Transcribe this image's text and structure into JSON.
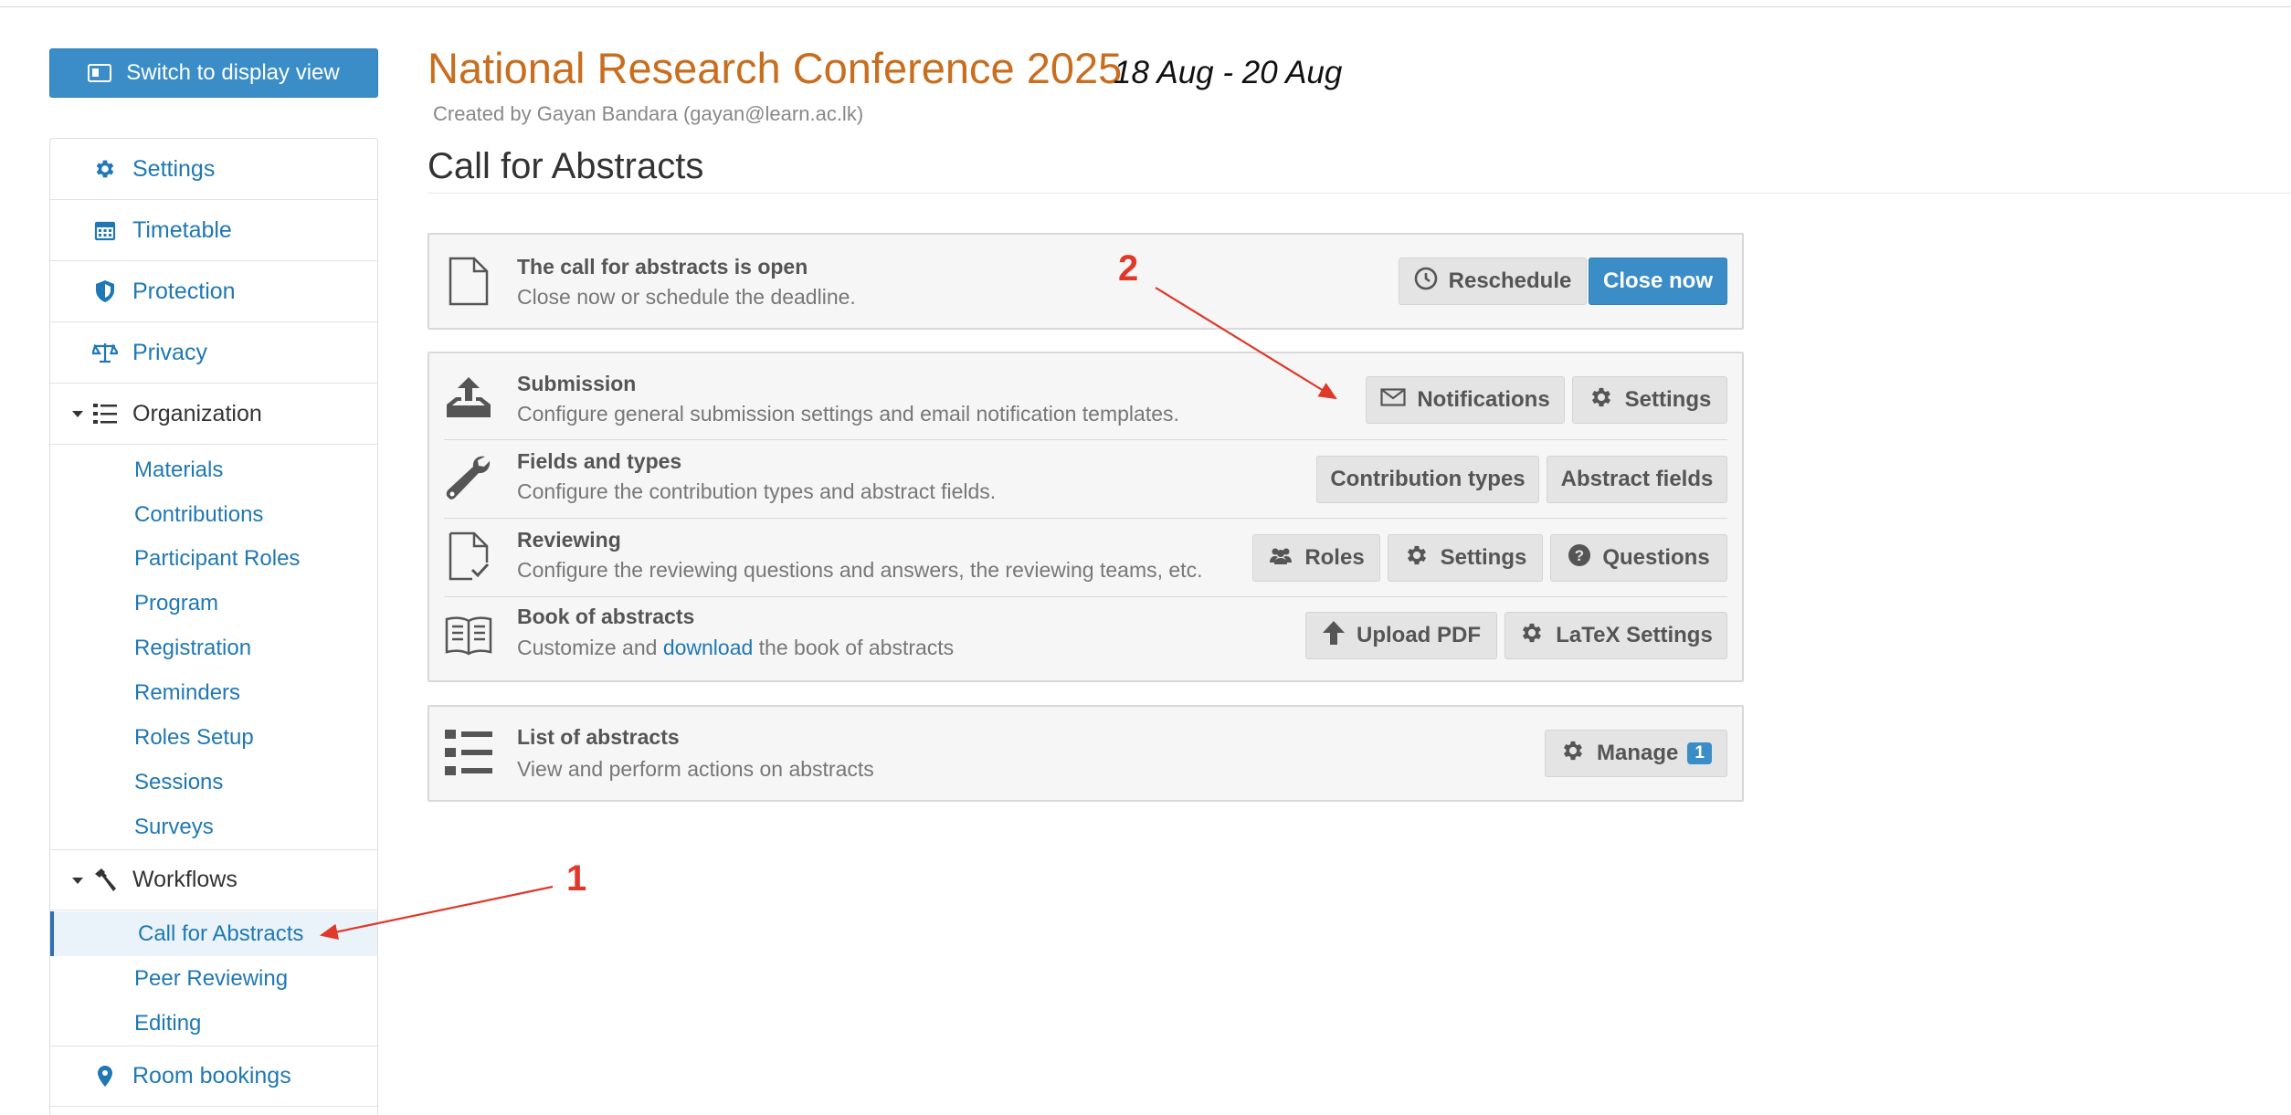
{
  "sidebar": {
    "switch_label": "Switch to display view",
    "items": [
      {
        "label": "Settings"
      },
      {
        "label": "Timetable"
      },
      {
        "label": "Protection"
      },
      {
        "label": "Privacy"
      }
    ],
    "organization": {
      "label": "Organization",
      "items": [
        "Materials",
        "Contributions",
        "Participant Roles",
        "Program",
        "Registration",
        "Reminders",
        "Roles Setup",
        "Sessions",
        "Surveys"
      ]
    },
    "workflows": {
      "label": "Workflows",
      "items": [
        "Call for Abstracts",
        "Peer Reviewing",
        "Editing"
      ],
      "active": "Call for Abstracts"
    },
    "room_bookings": "Room bookings"
  },
  "header": {
    "conference_title": "National Research Conference 2025",
    "dates": "18 Aug - 20 Aug",
    "created_by": "Created by Gayan Bandara (gayan@learn.ac.lk)",
    "page_title": "Call for Abstracts"
  },
  "status_panel": {
    "title": "The call for abstracts is open",
    "desc": "Close now or schedule the deadline.",
    "reschedule": "Reschedule",
    "close_now": "Close now"
  },
  "config_rows": [
    {
      "title": "Submission",
      "desc": "Configure general submission settings and email notification templates.",
      "buttons": [
        "Notifications",
        "Settings"
      ]
    },
    {
      "title": "Fields and types",
      "desc": "Configure the contribution types and abstract fields.",
      "buttons": [
        "Contribution types",
        "Abstract fields"
      ]
    },
    {
      "title": "Reviewing",
      "desc": "Configure the reviewing questions and answers, the reviewing teams, etc.",
      "buttons": [
        "Roles",
        "Settings",
        "Questions"
      ]
    },
    {
      "title": "Book of abstracts",
      "desc_pre": "Customize and ",
      "desc_link": "download",
      "desc_post": " the book of abstracts",
      "buttons": [
        "Upload PDF",
        "LaTeX Settings"
      ]
    }
  ],
  "list_panel": {
    "title": "List of abstracts",
    "desc": "View and perform actions on abstracts",
    "manage": "Manage",
    "badge": "1"
  },
  "annotations": {
    "one": "1",
    "two": "2",
    "color": "#e0382a"
  },
  "colors": {
    "link": "#1f78b4",
    "primary": "#3b8dc8",
    "title": "#c86e1e"
  }
}
